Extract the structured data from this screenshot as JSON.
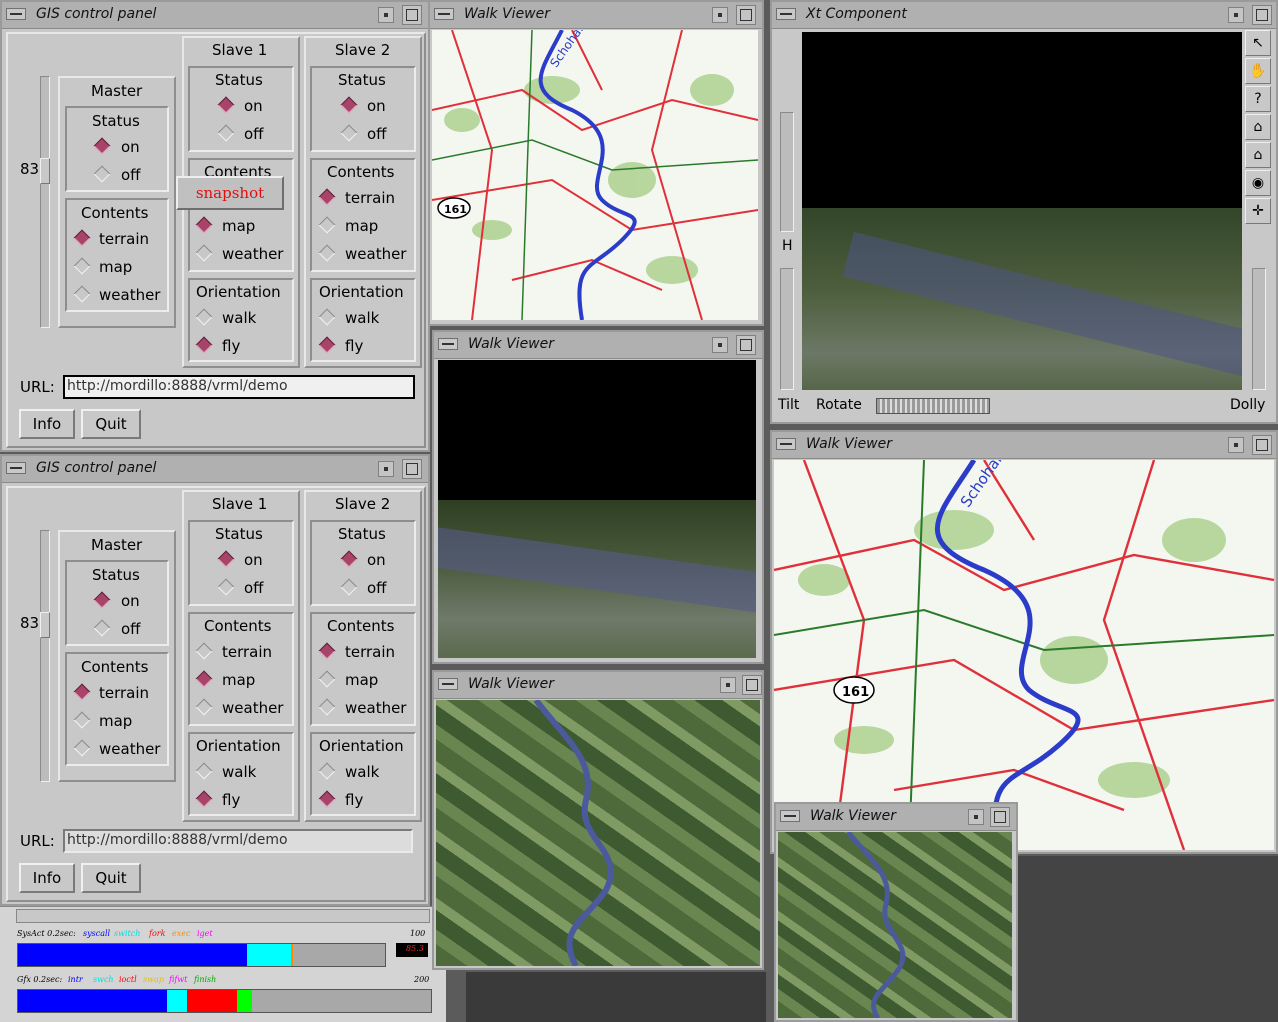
{
  "panels": [
    {
      "title": "GIS control panel",
      "slider_value": "83",
      "url_label": "URL:",
      "url_value": "http://mordillo:8888/vrml/demo",
      "info_label": "Info",
      "quit_label": "Quit",
      "master": {
        "title": "Master",
        "status_label": "Status",
        "status": [
          {
            "label": "on",
            "checked": true
          },
          {
            "label": "off",
            "checked": false
          }
        ],
        "contents_label": "Contents",
        "contents": [
          {
            "label": "terrain",
            "checked": true
          },
          {
            "label": "map",
            "checked": false
          },
          {
            "label": "weather",
            "checked": false
          }
        ]
      },
      "slave1": {
        "title": "Slave 1",
        "status_label": "Status",
        "status": [
          {
            "label": "on",
            "checked": true
          },
          {
            "label": "off",
            "checked": false
          }
        ],
        "contents_label": "Contents",
        "contents": [
          {
            "label": "terrain",
            "checked": false
          },
          {
            "label": "map",
            "checked": true
          },
          {
            "label": "weather",
            "checked": false
          }
        ],
        "orientation_label": "Orientation",
        "orientation": [
          {
            "label": "walk",
            "checked": false
          },
          {
            "label": "fly",
            "checked": true
          }
        ]
      },
      "slave2": {
        "title": "Slave 2",
        "status_label": "Status",
        "status": [
          {
            "label": "on",
            "checked": true
          },
          {
            "label": "off",
            "checked": false
          }
        ],
        "contents_label": "Contents",
        "contents": [
          {
            "label": "terrain",
            "checked": true
          },
          {
            "label": "map",
            "checked": false
          },
          {
            "label": "weather",
            "checked": false
          }
        ],
        "orientation_label": "Orientation",
        "orientation": [
          {
            "label": "walk",
            "checked": false
          },
          {
            "label": "fly",
            "checked": true
          }
        ]
      }
    },
    {
      "title": "GIS control panel",
      "slider_value": "83",
      "url_label": "URL:",
      "url_value": "http://mordillo:8888/vrml/demo",
      "info_label": "Info",
      "quit_label": "Quit",
      "master": {
        "title": "Master",
        "status_label": "Status",
        "status": [
          {
            "label": "on",
            "checked": true
          },
          {
            "label": "off",
            "checked": false
          }
        ],
        "contents_label": "Contents",
        "contents": [
          {
            "label": "terrain",
            "checked": true
          },
          {
            "label": "map",
            "checked": false
          },
          {
            "label": "weather",
            "checked": false
          }
        ]
      },
      "slave1": {
        "title": "Slave 1",
        "status_label": "Status",
        "status": [
          {
            "label": "on",
            "checked": true
          },
          {
            "label": "off",
            "checked": false
          }
        ],
        "contents_label": "Contents",
        "contents": [
          {
            "label": "terrain",
            "checked": false
          },
          {
            "label": "map",
            "checked": true
          },
          {
            "label": "weather",
            "checked": false
          }
        ],
        "orientation_label": "Orientation",
        "orientation": [
          {
            "label": "walk",
            "checked": false
          },
          {
            "label": "fly",
            "checked": true
          }
        ]
      },
      "slave2": {
        "title": "Slave 2",
        "status_label": "Status",
        "status": [
          {
            "label": "on",
            "checked": true
          },
          {
            "label": "off",
            "checked": false
          }
        ],
        "contents_label": "Contents",
        "contents": [
          {
            "label": "terrain",
            "checked": true
          },
          {
            "label": "map",
            "checked": false
          },
          {
            "label": "weather",
            "checked": false
          }
        ],
        "orientation_label": "Orientation",
        "orientation": [
          {
            "label": "walk",
            "checked": false
          },
          {
            "label": "fly",
            "checked": true
          }
        ]
      }
    }
  ],
  "popup": {
    "label": "snapshot"
  },
  "walk_viewer_title": "Walk Viewer",
  "xt": {
    "title": "Xt Component",
    "h_label": "H",
    "tilt_label": "Tilt",
    "rotate_label": "Rotate",
    "dolly_label": "Dolly",
    "tools": [
      "arrow-pointer-icon",
      "hand-icon",
      "question-icon",
      "home-icon",
      "set-home-icon",
      "eye-icon",
      "crosshair-icon"
    ],
    "tool_glyphs": [
      "↖",
      "✋",
      "?",
      "⌂",
      "⌂",
      "◉",
      "✛"
    ]
  },
  "map_labels": {
    "route": "161",
    "river": "Schoharie"
  },
  "perf": {
    "sys_label": "SysAct 0.2sec:",
    "sys_legend": [
      {
        "label": "syscall",
        "color": "#0000ff"
      },
      {
        "label": "switch",
        "color": "#00ffff"
      },
      {
        "label": "fork",
        "color": "#ff0000"
      },
      {
        "label": "exec",
        "color": "#ff8800"
      },
      {
        "label": "iget",
        "color": "#ff00ff"
      }
    ],
    "sys_max": "100",
    "sys_value": "85.3",
    "sys_fractions": [
      0.71,
      0.13,
      0.005
    ],
    "gfx_label": "Gfx 0.2sec:",
    "gfx_legend": [
      {
        "label": "intr",
        "color": "#0000ff"
      },
      {
        "label": "swch",
        "color": "#00ffff"
      },
      {
        "label": "ioctl",
        "color": "#ff0000"
      },
      {
        "label": "swap",
        "color": "#ffff00"
      },
      {
        "label": "fifwt",
        "color": "#ff00ff"
      },
      {
        "label": "finish",
        "color": "#00cc00"
      }
    ],
    "gfx_max": "200",
    "gfx_fractions": [
      0.36,
      0.05,
      0.12,
      0.035
    ]
  }
}
